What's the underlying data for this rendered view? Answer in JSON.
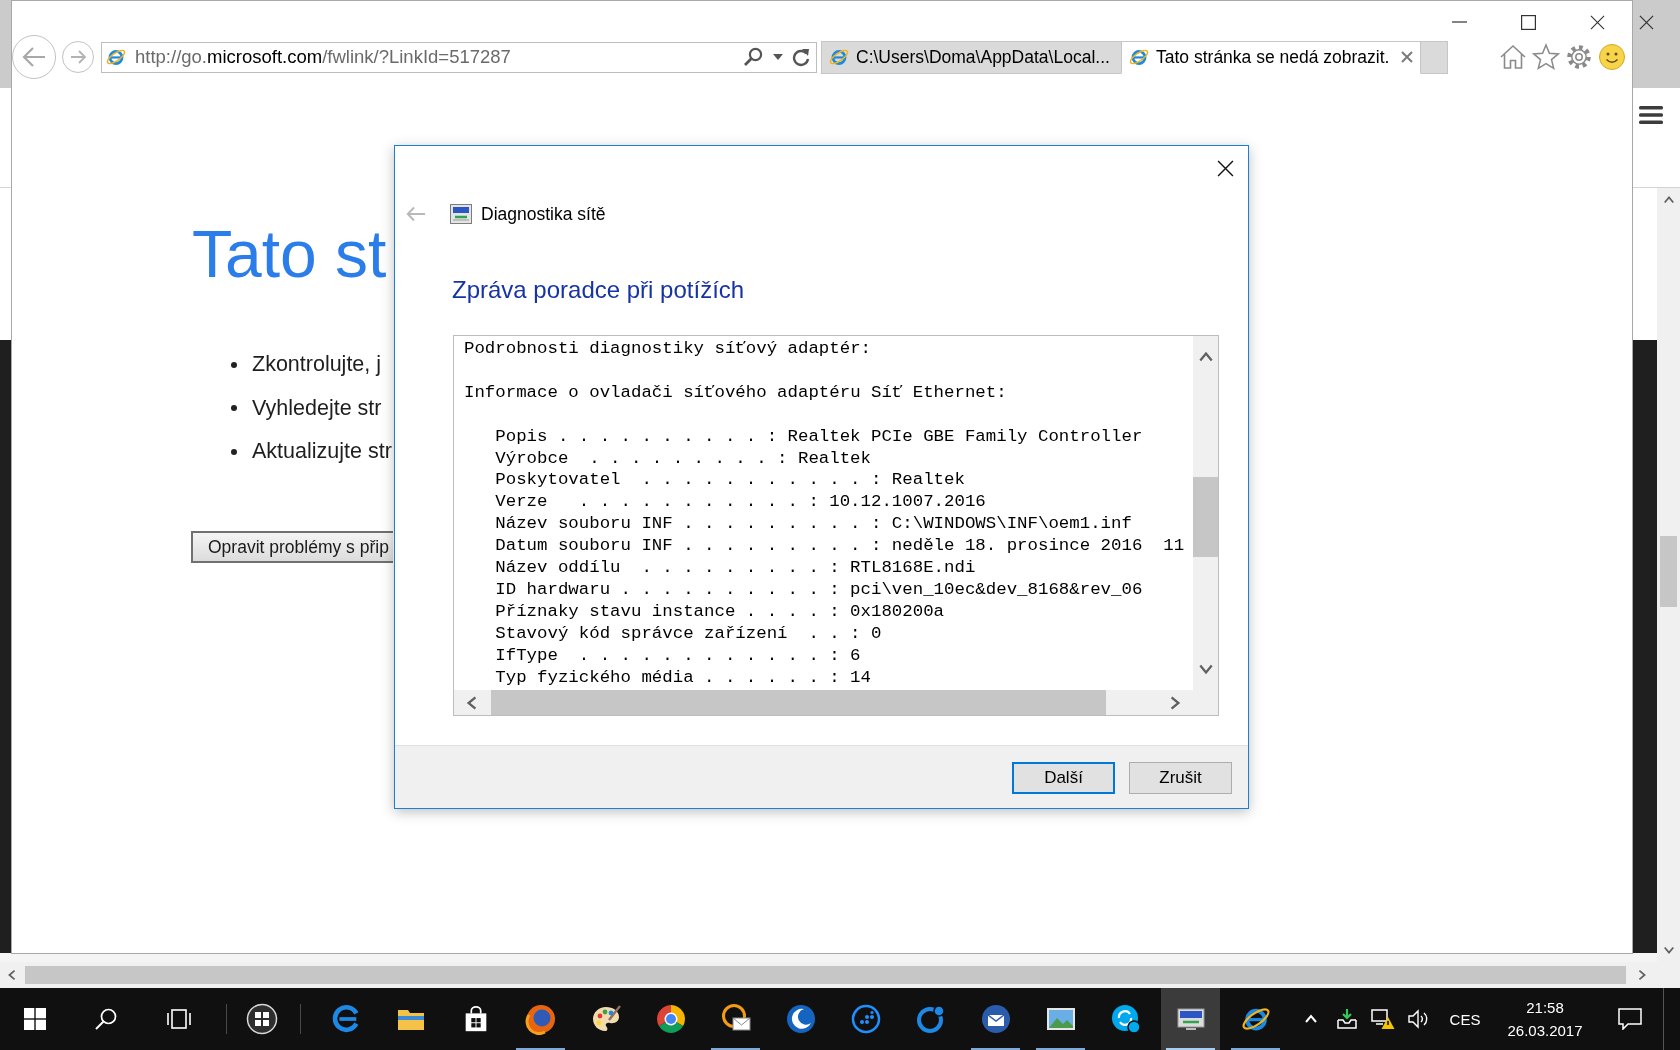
{
  "browser": {
    "address_bar": {
      "url": "http://go.**microsoft.com**/fwlink/?LinkId=517287"
    },
    "tabs": [
      {
        "title": "C:\\Users\\Doma\\AppData\\Local...",
        "selected": false
      },
      {
        "title": "Tato stránka se nedá zobrazit.",
        "selected": true
      }
    ],
    "page": {
      "heading": "Tato st",
      "bullets": [
        "Zkontrolujte, j",
        "Vyhledejte str",
        "Aktualizujte str"
      ],
      "button": "Opravit problémy s přip"
    }
  },
  "dialog": {
    "back": {
      "disabled": true
    },
    "title": "Diagnostika sítě",
    "heading": "Zpráva poradce při potížích",
    "report": {
      "title": "Podrobnosti diagnostiky síťový adaptér:",
      "section": "Informace o ovladači síťového adaptéru Síť Ethernet:",
      "entries": [
        "Popis . . . . . . . . . . : Realtek PCIe GBE Family Controller",
        "Výrobce  . . . . . . . . . : Realtek",
        "Poskytovatel  . . . . . . . . . . . : Realtek",
        "Verze   . . . . . . . . . . . : 10.12.1007.2016",
        "Název souboru INF . . . . . . . . . : C:\\WINDOWS\\INF\\oem1.inf",
        "Datum souboru INF . . . . . . . . . : neděle 18. prosince 2016  11",
        "Název oddílu  . . . . . . . . . : RTL8168E.ndi",
        "ID hardwaru . . . . . . . . . . : pci\\ven_10ec&dev_8168&rev_06",
        "Příznaky stavu instance . . . . : 0x180200a",
        "Stavový kód správce zařízení  . . : 0",
        "IfType  . . . . . . . . . . . . : 6",
        "Typ fyzického média . . . . . . : 14"
      ]
    },
    "buttons": [
      {
        "label": "Další",
        "default": true
      },
      {
        "label": "Zrušit",
        "default": false
      }
    ]
  },
  "taskbar": {
    "apps": [
      {
        "running": false,
        "selected": false
      },
      {
        "running": false,
        "selected": false
      },
      {
        "running": false,
        "selected": false
      },
      {
        "running": true,
        "selected": false
      },
      {
        "running": false,
        "selected": false
      },
      {
        "running": false,
        "selected": false
      },
      {
        "running": true,
        "selected": false
      },
      {
        "running": false,
        "selected": false
      },
      {
        "running": false,
        "selected": false
      },
      {
        "running": false,
        "selected": false
      },
      {
        "running": true,
        "selected": false
      },
      {
        "running": true,
        "selected": false
      },
      {
        "running": false,
        "selected": false
      },
      {
        "running": true,
        "selected": true
      },
      {
        "running": true,
        "selected": false
      }
    ],
    "language": "CES",
    "time": "21:58",
    "date": "26.03.2017"
  }
}
